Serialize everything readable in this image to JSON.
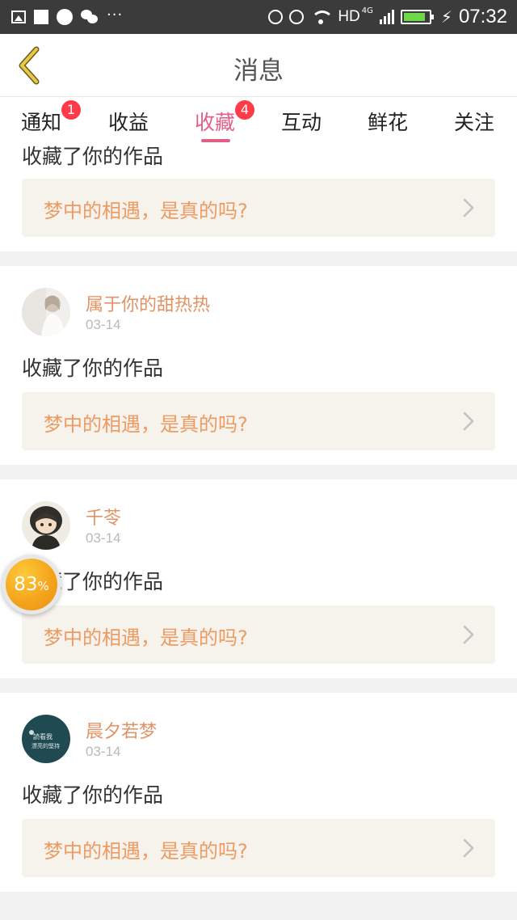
{
  "status_bar": {
    "dots": "···",
    "network": "HD",
    "network_gen": "4G",
    "time": "07:32",
    "battery_level": 0.85,
    "battery_color": "#6fd84a"
  },
  "header": {
    "title": "消息",
    "back_icon": "chevron-left-icon"
  },
  "tabs": [
    {
      "label": "通知",
      "badge": "1"
    },
    {
      "label": "收益"
    },
    {
      "label": "收藏",
      "badge": "4",
      "active": true
    },
    {
      "label": "互动"
    },
    {
      "label": "鲜花"
    },
    {
      "label": "关注"
    }
  ],
  "top_partial": {
    "action": "收藏了你的作品",
    "work_title": "梦中的相遇，是真的吗?"
  },
  "items": [
    {
      "name": "属于你的甜热热",
      "date": "03-14",
      "action": "收藏了你的作品",
      "work_title": "梦中的相遇，是真的吗?"
    },
    {
      "name": "千苓",
      "date": "03-14",
      "action": "收藏了你的作品",
      "work_title": "梦中的相遇，是真的吗?"
    },
    {
      "name": "晨夕若梦",
      "date": "03-14",
      "action": "收藏了你的作品",
      "work_title": "梦中的相遇，是真的吗?"
    }
  ],
  "avatar_texts": [
    "読看我",
    "漂亮的堅持"
  ],
  "progress": {
    "value": "83",
    "unit": "%"
  },
  "colors": {
    "accent": "#e45f86",
    "name": "#e19365",
    "work_title": "#ee9a63",
    "badge": "#ff3b4a"
  }
}
